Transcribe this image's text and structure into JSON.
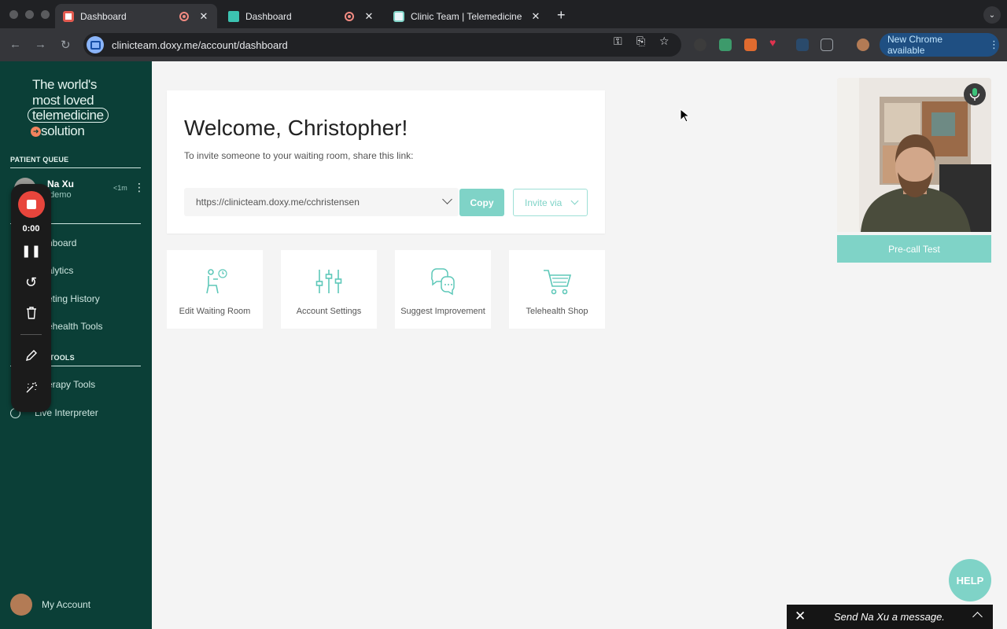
{
  "browser": {
    "tabs": [
      {
        "title": "Dashboard",
        "active": true,
        "recording": true
      },
      {
        "title": "Dashboard",
        "active": false,
        "recording": true
      },
      {
        "title": "Clinic Team | Telemedicine",
        "active": false,
        "recording": false
      }
    ],
    "new_tab_label": "+",
    "url_domain": "clinicteam.doxy.me",
    "url_path": "/account/dashboard",
    "update_label": "New Chrome available"
  },
  "sidebar": {
    "tagline_line1": "The world's",
    "tagline_line2": "most loved",
    "tagline_line3": "telemedicine",
    "tagline_line4": "solution",
    "patient_queue_heading": "PATIENT QUEUE",
    "patient": {
      "name": "Na Xu",
      "room": "/demo",
      "wait": "<1m"
    },
    "nav_items": [
      "hboard",
      "alytics",
      "eting History",
      "ehealth Tools"
    ],
    "tools_heading": "TOOLS",
    "tool_items": [
      "erapy Tools",
      "Live Interpreter"
    ],
    "my_account_label": "My Account"
  },
  "recorder": {
    "time": "0:00"
  },
  "main": {
    "welcome_title": "Welcome, Christopher!",
    "welcome_subtitle": "To invite someone to your waiting room, share this link:",
    "room_link": "https://clinicteam.doxy.me/cchristensen",
    "copy_label": "Copy",
    "invite_label": "Invite via",
    "tiles": [
      {
        "label": "Edit Waiting Room",
        "icon": "waiting-room-icon"
      },
      {
        "label": "Account Settings",
        "icon": "sliders-icon"
      },
      {
        "label": "Suggest Improvement",
        "icon": "chat-bubbles-icon"
      },
      {
        "label": "Telehealth Shop",
        "icon": "shopping-cart-icon"
      }
    ]
  },
  "video": {
    "precall_label": "Pre-call Test"
  },
  "help_label": "HELP",
  "chat": {
    "message_placeholder": "Send Na Xu a message."
  },
  "colors": {
    "sidebar_bg": "#0b3f37",
    "accent": "#7fd3c7",
    "record_red": "#e8453c"
  }
}
